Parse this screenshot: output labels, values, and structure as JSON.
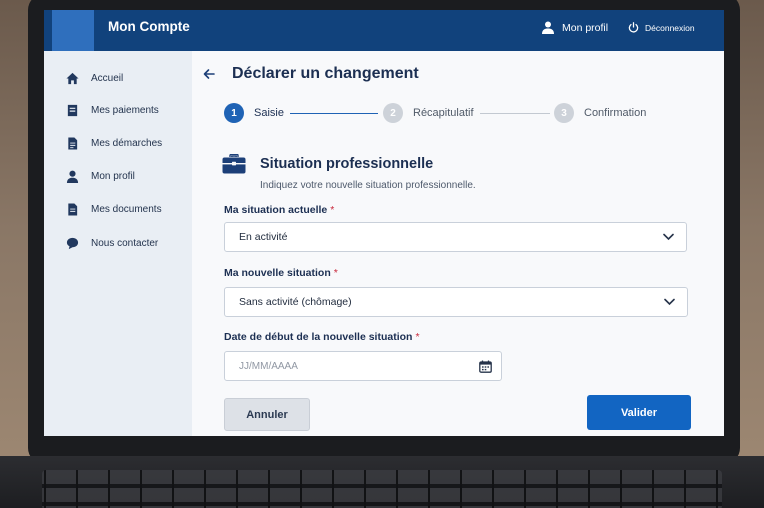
{
  "header": {
    "brand": "Mon Compte",
    "profile_label": "Mon profil",
    "logout_label": "Déconnexion"
  },
  "sidebar": {
    "items": [
      {
        "label": "Accueil",
        "icon": "home-icon"
      },
      {
        "label": "Mes paiements",
        "icon": "payment-icon"
      },
      {
        "label": "Mes démarches",
        "icon": "document-icon"
      },
      {
        "label": "Mon profil",
        "icon": "user-icon"
      },
      {
        "label": "Mes documents",
        "icon": "file-icon"
      },
      {
        "label": "Nous contacter",
        "icon": "chat-icon"
      }
    ]
  },
  "page": {
    "title": "Déclarer un changement"
  },
  "steps": [
    {
      "number": "1",
      "label": "Saisie",
      "state": "active"
    },
    {
      "number": "2",
      "label": "Récapitulatif",
      "state": "inactive"
    },
    {
      "number": "3",
      "label": "Confirmation",
      "state": "inactive"
    }
  ],
  "section": {
    "title": "Situation professionnelle",
    "subtitle": "Indiquez votre nouvelle situation professionnelle.",
    "icon": "briefcase-icon"
  },
  "form": {
    "current_label": "Ma situation actuelle",
    "current_value": "En activité",
    "new_label": "Ma nouvelle situation",
    "new_value": "Sans activité (chômage)",
    "date_label": "Date de début de la nouvelle situation",
    "date_placeholder": "JJ/MM/AAAA",
    "required_mark": "*"
  },
  "actions": {
    "cancel_label": "Annuler",
    "submit_label": "Valider"
  },
  "colors": {
    "header_bg": "#11427c",
    "primary": "#1265c2",
    "required": "#c8283b"
  }
}
